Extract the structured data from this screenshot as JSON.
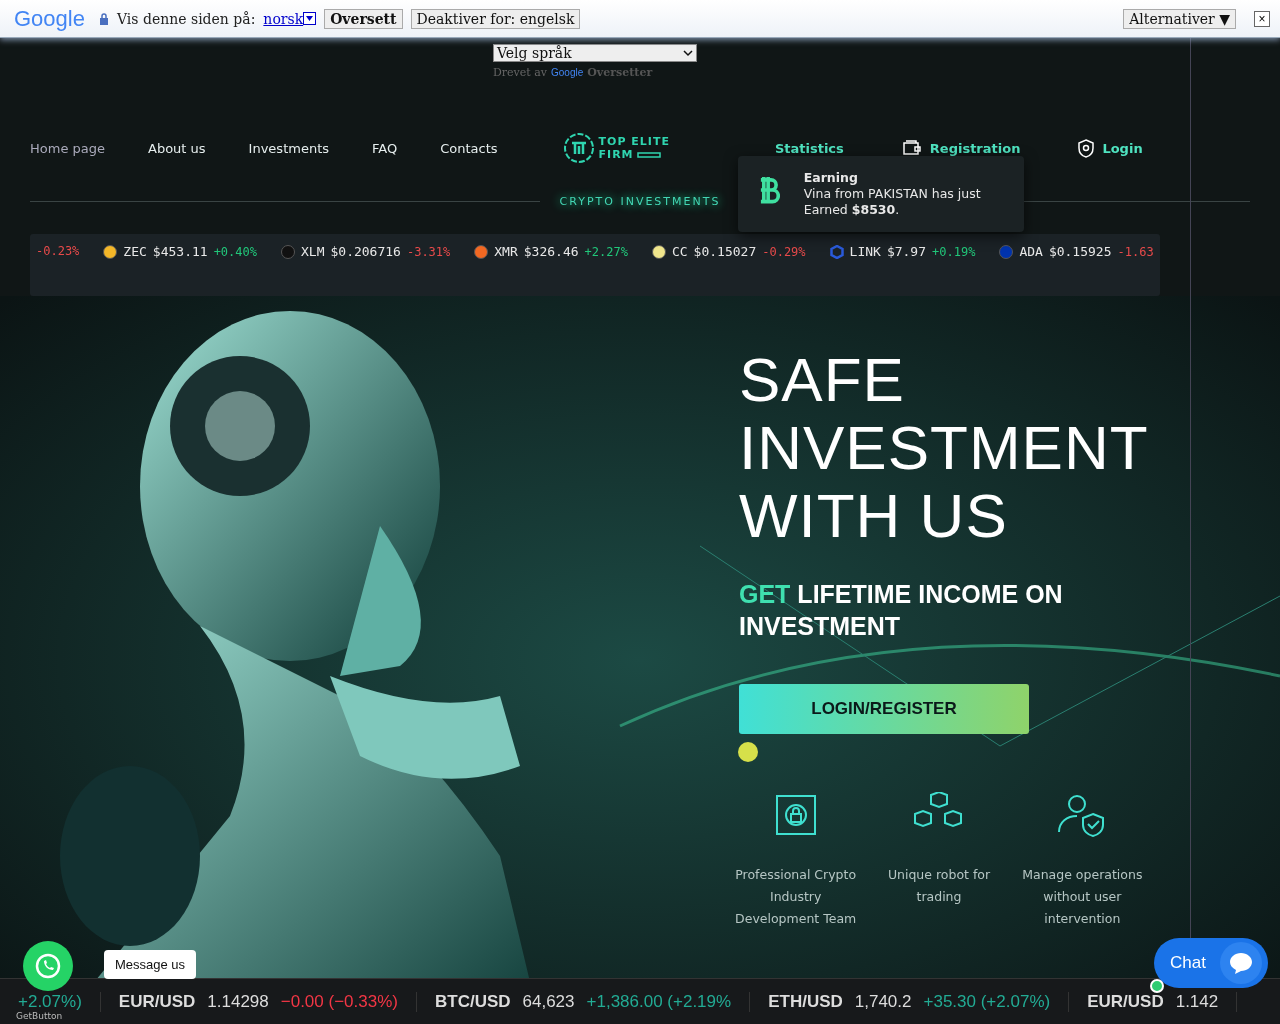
{
  "translate_bar": {
    "logo": "Google",
    "prompt": "Vis denne siden på:",
    "language": "norsk",
    "translate_button": "Oversett",
    "disable_button": "Deaktiver for: engelsk",
    "options_button": "Alternativer ▼",
    "close": "×"
  },
  "language_picker": {
    "value": "Velg språk",
    "powered_by": "Drevet av",
    "brand": "Google",
    "product": "Oversetter"
  },
  "nav": {
    "left": [
      {
        "label": "Home page",
        "selected": true
      },
      {
        "label": "About us",
        "selected": false
      },
      {
        "label": "Investments",
        "selected": false
      },
      {
        "label": "FAQ",
        "selected": false
      },
      {
        "label": "Contacts",
        "selected": false
      }
    ],
    "logo": {
      "line1": "TOP ELITE",
      "line2": "FIRM"
    },
    "right": [
      {
        "label": "Statistics",
        "kind": "plain"
      },
      {
        "label": "Registration",
        "kind": "wallet"
      },
      {
        "label": "Login",
        "kind": "shield"
      }
    ],
    "tagline": "CRYPTO INVESTMENTS"
  },
  "notification": {
    "title": "Earning",
    "message": "Vina from PAKISTAN has just Earned **$8530**."
  },
  "ticker": [
    {
      "change": "-0.23%",
      "color": "#e84a4a"
    },
    {
      "kind": "zec",
      "symbol": "ZEC",
      "price": "$453.11",
      "change": "+0.40%",
      "color": "#21c77a"
    },
    {
      "kind": "xlm",
      "symbol": "XLM",
      "price": "$0.206716",
      "change": "-3.31%",
      "color": "#e84a4a"
    },
    {
      "kind": "xmr",
      "symbol": "XMR",
      "price": "$326.46",
      "change": "+2.27%",
      "color": "#21c77a"
    },
    {
      "kind": "cc",
      "symbol": "CC",
      "price": "$0.15027",
      "change": "-0.29%",
      "color": "#e84a4a"
    },
    {
      "kind": "link",
      "symbol": "LINK",
      "price": "$7.97",
      "change": "+0.19%",
      "color": "#21c77a"
    },
    {
      "kind": "ada",
      "symbol": "ADA",
      "price": "$0.15925",
      "change": "-1.63",
      "color": "#e84a4a"
    }
  ],
  "hero": {
    "title_lines": [
      "SAFE",
      "INVESTMENT",
      "WITH US"
    ],
    "subtitle_accent": "GET",
    "subtitle_rest": "LIFETIME INCOME ON INVESTMENT",
    "button": "LOGIN/REGISTER",
    "features": [
      {
        "kind": "network",
        "text": "Professional Crypto Industry Development Team"
      },
      {
        "kind": "cubes",
        "text": "Unique robot for trading"
      },
      {
        "kind": "user-shield",
        "text": "Manage operations without user intervention"
      }
    ]
  },
  "whatsapp": {
    "bubble": "Message us",
    "credit": "GetButton"
  },
  "fx_ticker": [
    {
      "change": "+2.07%)",
      "color": "#22ab94"
    },
    {
      "pair": "EUR/USD",
      "price": "1.14298",
      "change": "−0.00 (−0.33%)",
      "color": "#f23645"
    },
    {
      "pair": "BTC/USD",
      "price": "64,623",
      "change": "+1,386.00 (+2.19%",
      "color": "#22ab94"
    },
    {
      "pair": "ETH/USD",
      "price": "1,740.2",
      "change": "+35.30 (+2.07%)",
      "color": "#22ab94"
    },
    {
      "pair": "EUR/USD",
      "price": "1.142"
    }
  ],
  "chat": {
    "label": "Chat",
    "online": true
  }
}
